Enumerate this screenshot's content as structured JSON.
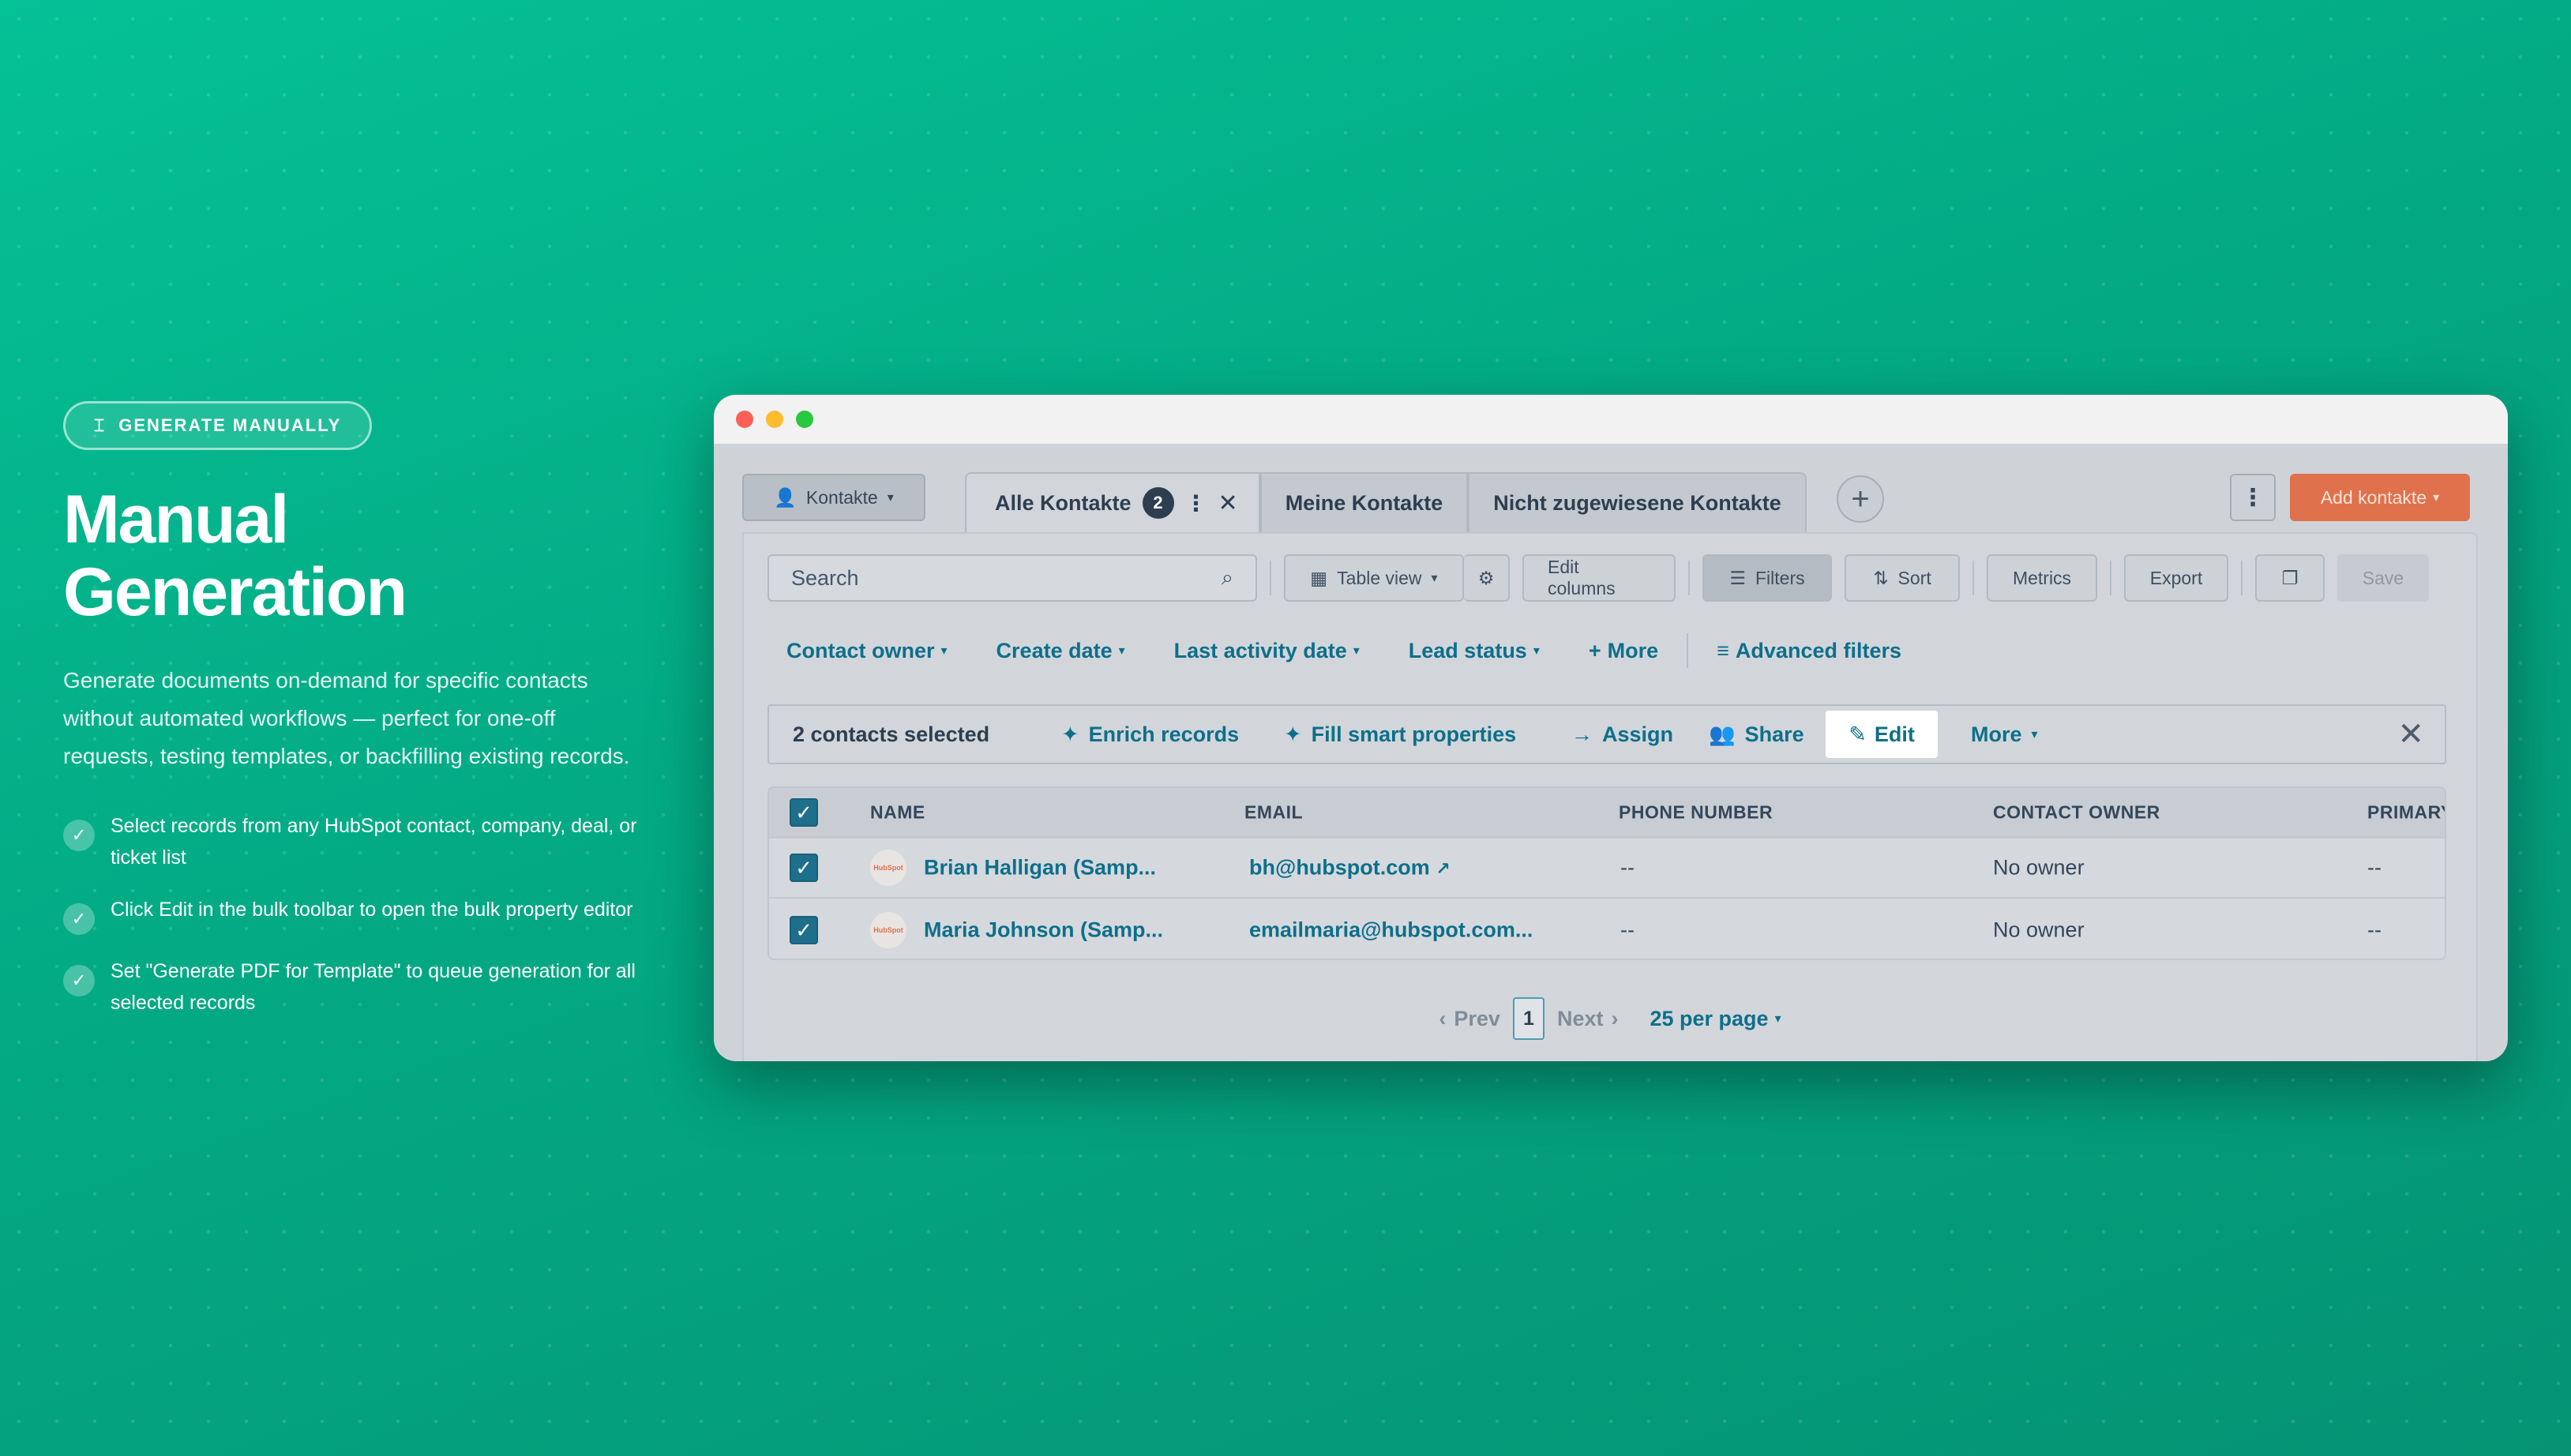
{
  "hero": {
    "pill_label": "GENERATE MANUALLY",
    "pill_icon": "document-icon",
    "title_line1": "Manual",
    "title_line2": "Generation",
    "description": "Generate documents on-demand for specific contacts without automated workflows — perfect for one-off requests, testing templates, or backfilling existing records.",
    "bullets": [
      "Select records from any HubSpot contact, company, deal, or ticket list",
      "Click Edit in the bulk toolbar to open the bulk property editor",
      "Set \"Generate PDF for Template\" to queue generation for all selected records"
    ]
  },
  "app": {
    "object_selector": "Kontakte",
    "tabs": [
      {
        "label": "Alle Kontakte",
        "badge": "2",
        "active": true
      },
      {
        "label": "Meine Kontakte"
      },
      {
        "label": "Nicht zugewiesene Kontakte"
      }
    ],
    "add_button": "Add kontakte",
    "toolbar": {
      "search_placeholder": "Search",
      "table_view": "Table view",
      "edit_columns": "Edit columns",
      "filters": "Filters",
      "sort": "Sort",
      "metrics": "Metrics",
      "export": "Export",
      "save": "Save"
    },
    "filters": [
      "Contact owner",
      "Create date",
      "Last activity date",
      "Lead status"
    ],
    "filters_more": "More",
    "advanced_filters": "Advanced filters",
    "bulk": {
      "count": "2 contacts selected",
      "enrich": "Enrich records",
      "fill": "Fill smart properties",
      "assign": "Assign",
      "share": "Share",
      "edit": "Edit",
      "more": "More"
    },
    "table": {
      "columns": [
        "NAME",
        "EMAIL",
        "PHONE NUMBER",
        "CONTACT OWNER",
        "PRIMARY"
      ],
      "avatar_text": "HubSpot",
      "rows": [
        {
          "name": "Brian Halligan (Samp...",
          "email": "bh@hubspot.com",
          "phone": "--",
          "owner": "No owner",
          "primary": "--"
        },
        {
          "name": "Maria Johnson (Samp...",
          "email": "emailmaria@hubspot.com...",
          "phone": "--",
          "owner": "No owner",
          "primary": "--"
        }
      ]
    },
    "pagination": {
      "prev": "Prev",
      "page": "1",
      "next": "Next",
      "per_page": "25 per page"
    }
  },
  "colors": {
    "background": "#03a983",
    "accent_link": "#0e6f8a",
    "add_button": "#e0714d"
  }
}
